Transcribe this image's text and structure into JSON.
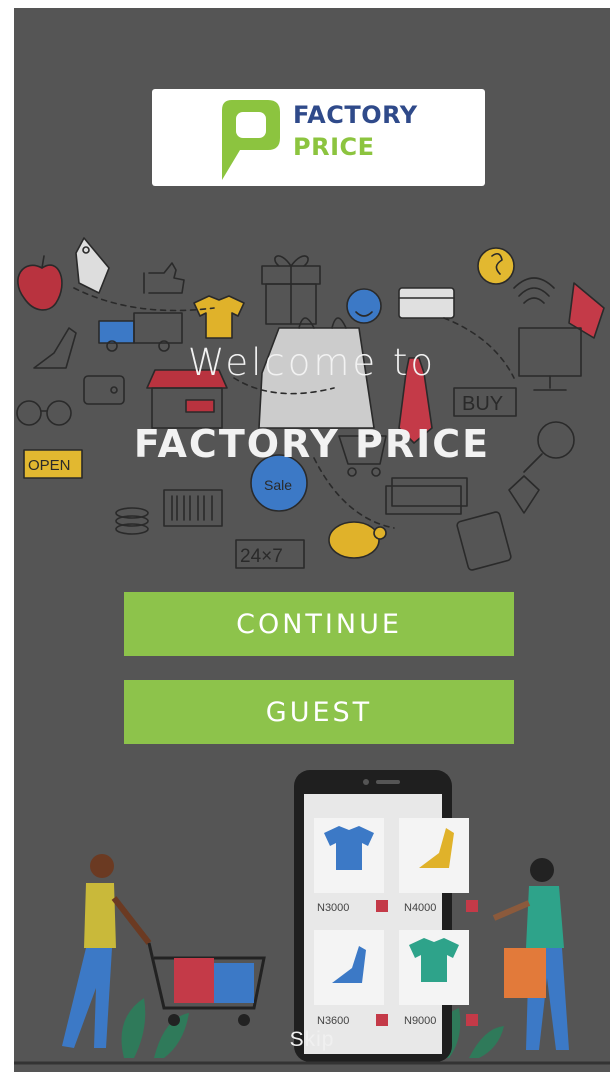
{
  "logo": {
    "line1": "FACTORY",
    "line2": "PRICE",
    "icon": "speech-bubble-p-icon"
  },
  "welcome_text": "Welcome to",
  "brand_text": "FACTORY PRICE",
  "buttons": {
    "continue": "CONTINUE",
    "guest": "GUEST"
  },
  "skip_label": "Skip",
  "doodle_labels": {
    "open": "OPEN",
    "buy": "BUY",
    "hours": "24×7",
    "sale": "Sale"
  },
  "products": [
    {
      "price": "N3000",
      "item": "t-shirt"
    },
    {
      "price": "N4000",
      "item": "heel-shoe"
    },
    {
      "price": "N3600",
      "item": "heel-shoe"
    },
    {
      "price": "N9000",
      "item": "t-shirt"
    }
  ],
  "colors": {
    "accent": "#8dc34b",
    "logo_blue": "#2f4a8a",
    "logo_green": "#8cc43f",
    "overlay": "#555555"
  }
}
